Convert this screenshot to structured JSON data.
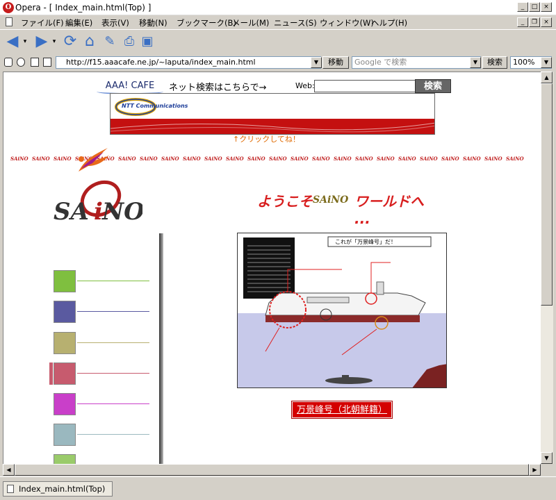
{
  "window": {
    "title": "Opera - [ Index_main.html(Top) ]"
  },
  "menu": {
    "items": [
      "ファイル(F)",
      "編集(E)",
      "表示(V)",
      "移動(N)",
      "ブックマーク(B)",
      "メール(M)",
      "ニュース(S)",
      "ウィンドウ(W)",
      "ヘルプ(H)"
    ]
  },
  "address": {
    "url": "http://f15.aaacafe.ne.jp/~laputa/index_main.html",
    "go_label": "移動",
    "search_placeholder": "Google で検索",
    "search_label": "検索",
    "zoom": "100%"
  },
  "page": {
    "aaa_cafe": "AAA! CAFE",
    "search_text": "ネット検索はこちらで→",
    "web_label": "Web:",
    "search_button": "検索",
    "ntt_text": "NTT Communications",
    "click_text": "↑クリックしてね！",
    "saino_word": "SAiNO",
    "welcome_left": "ようこそ",
    "welcome_right": "ワールドへ ...",
    "ship_title": "これが「万景峰号」だ！",
    "ship_caption": "万景峰号（北朝鮮籍）",
    "nav_colors": [
      "#7fbf3f",
      "#5a5aa0",
      "#b7b070",
      "#c75b6e",
      "#c93fc9",
      "#9ab8bf",
      "#9acb6a"
    ]
  },
  "status": {
    "tab_label": "Index_main.html(Top)"
  }
}
